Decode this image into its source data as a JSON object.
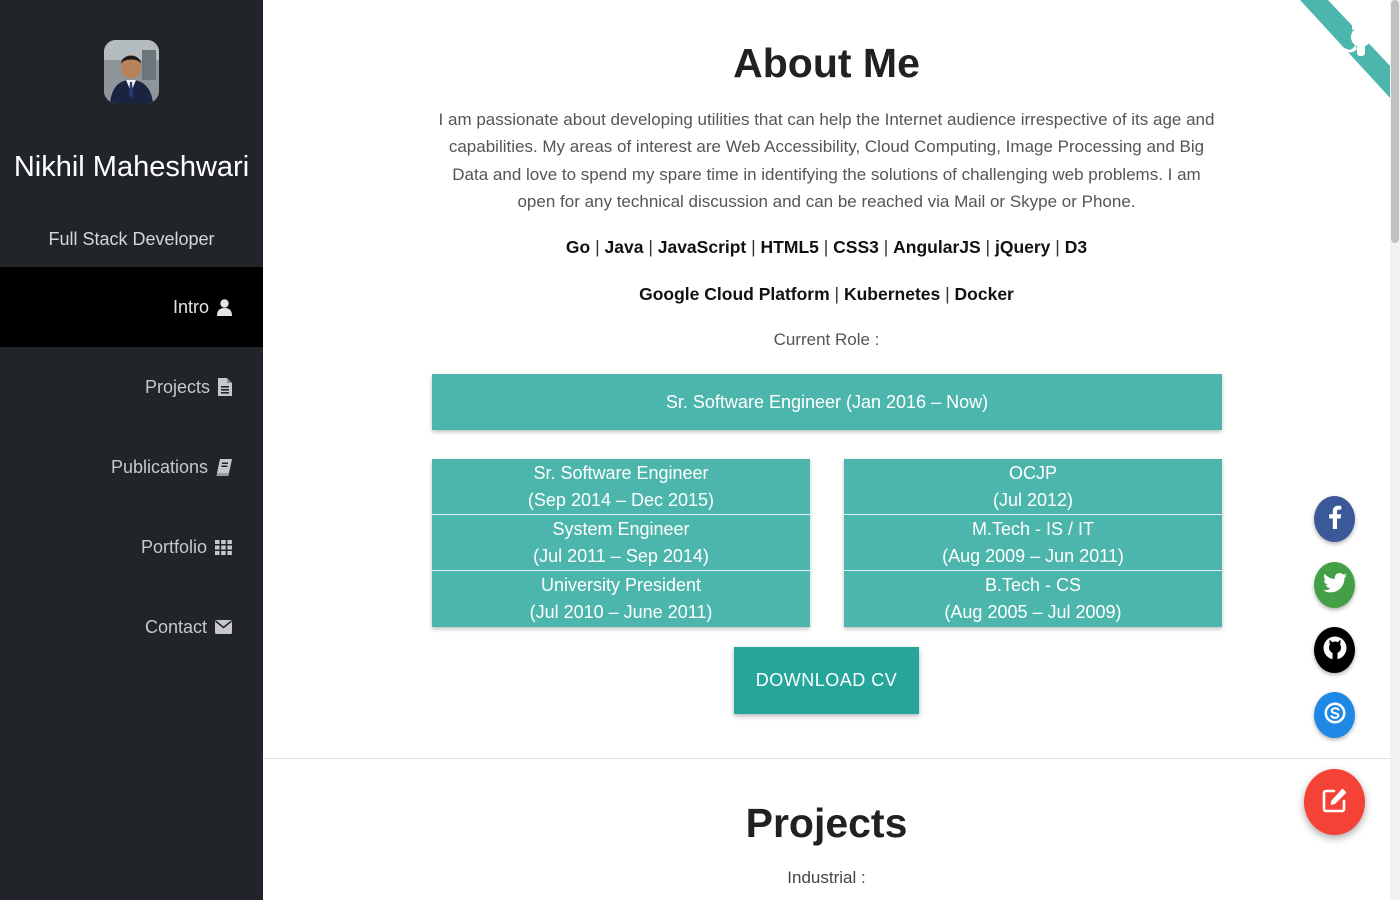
{
  "profile": {
    "name": "Nikhil Maheshwari",
    "role": "Full Stack Developer"
  },
  "nav": {
    "items": [
      {
        "label": "Intro",
        "icon": "user-icon",
        "active": true
      },
      {
        "label": "Projects",
        "icon": "file-icon"
      },
      {
        "label": "Publications",
        "icon": "book-icon"
      },
      {
        "label": "Portfolio",
        "icon": "grid-icon"
      },
      {
        "label": "Contact",
        "icon": "envelope-icon"
      }
    ]
  },
  "about": {
    "title": "About Me",
    "text": "I am passionate about developing utilities that can help the Internet audience irrespective of its age and capabilities. My areas of interest are Web Accessibility, Cloud Computing, Image Processing and Big Data and love to spend my spare time in identifying the solutions of challenging web problems. I am open for any technical discussion and can be reached via Mail or Skype or Phone.",
    "skills_line_1": [
      "Go",
      "Java",
      "JavaScript",
      "HTML5",
      "CSS3",
      "AngularJS",
      "jQuery",
      "D3"
    ],
    "skills_line_2": [
      "Google Cloud Platform",
      "Kubernetes",
      "Docker"
    ],
    "separator": " | ",
    "current_role_label": "Current Role :",
    "current_role": "Sr. Software Engineer (Jan 2016 – Now)",
    "experience": [
      {
        "title": "Sr. Software Engineer",
        "period": "(Sep 2014 – Dec 2015)"
      },
      {
        "title": "System Engineer",
        "period": "(Jul 2011 – Sep 2014)"
      },
      {
        "title": "University President",
        "period": "(Jul 2010 – June 2011)"
      }
    ],
    "education": [
      {
        "title": "OCJP",
        "period": "(Jul 2012)"
      },
      {
        "title": "M.Tech - IS / IT",
        "period": "(Aug 2009 – Jun 2011)"
      },
      {
        "title": "B.Tech - CS",
        "period": "(Aug 2005 – Jul 2009)"
      }
    ],
    "download_label": "DOWNLOAD CV"
  },
  "projects": {
    "title": "Projects",
    "industrial_label": "Industrial :"
  },
  "social": {
    "icons": [
      "facebook-icon",
      "twitter-icon",
      "github-icon",
      "skype-icon"
    ]
  },
  "fab": {
    "icon": "edit-icon"
  },
  "corner": {
    "icon": "github-octocat-icon"
  },
  "colors": {
    "sidebar": "#212529",
    "active_nav": "#000000",
    "teal": "#4db6ac",
    "button_teal": "#26a69a",
    "facebook": "#3b5998",
    "twitter": "#43a047",
    "skype": "#1e88e5",
    "fab": "#f44336"
  }
}
